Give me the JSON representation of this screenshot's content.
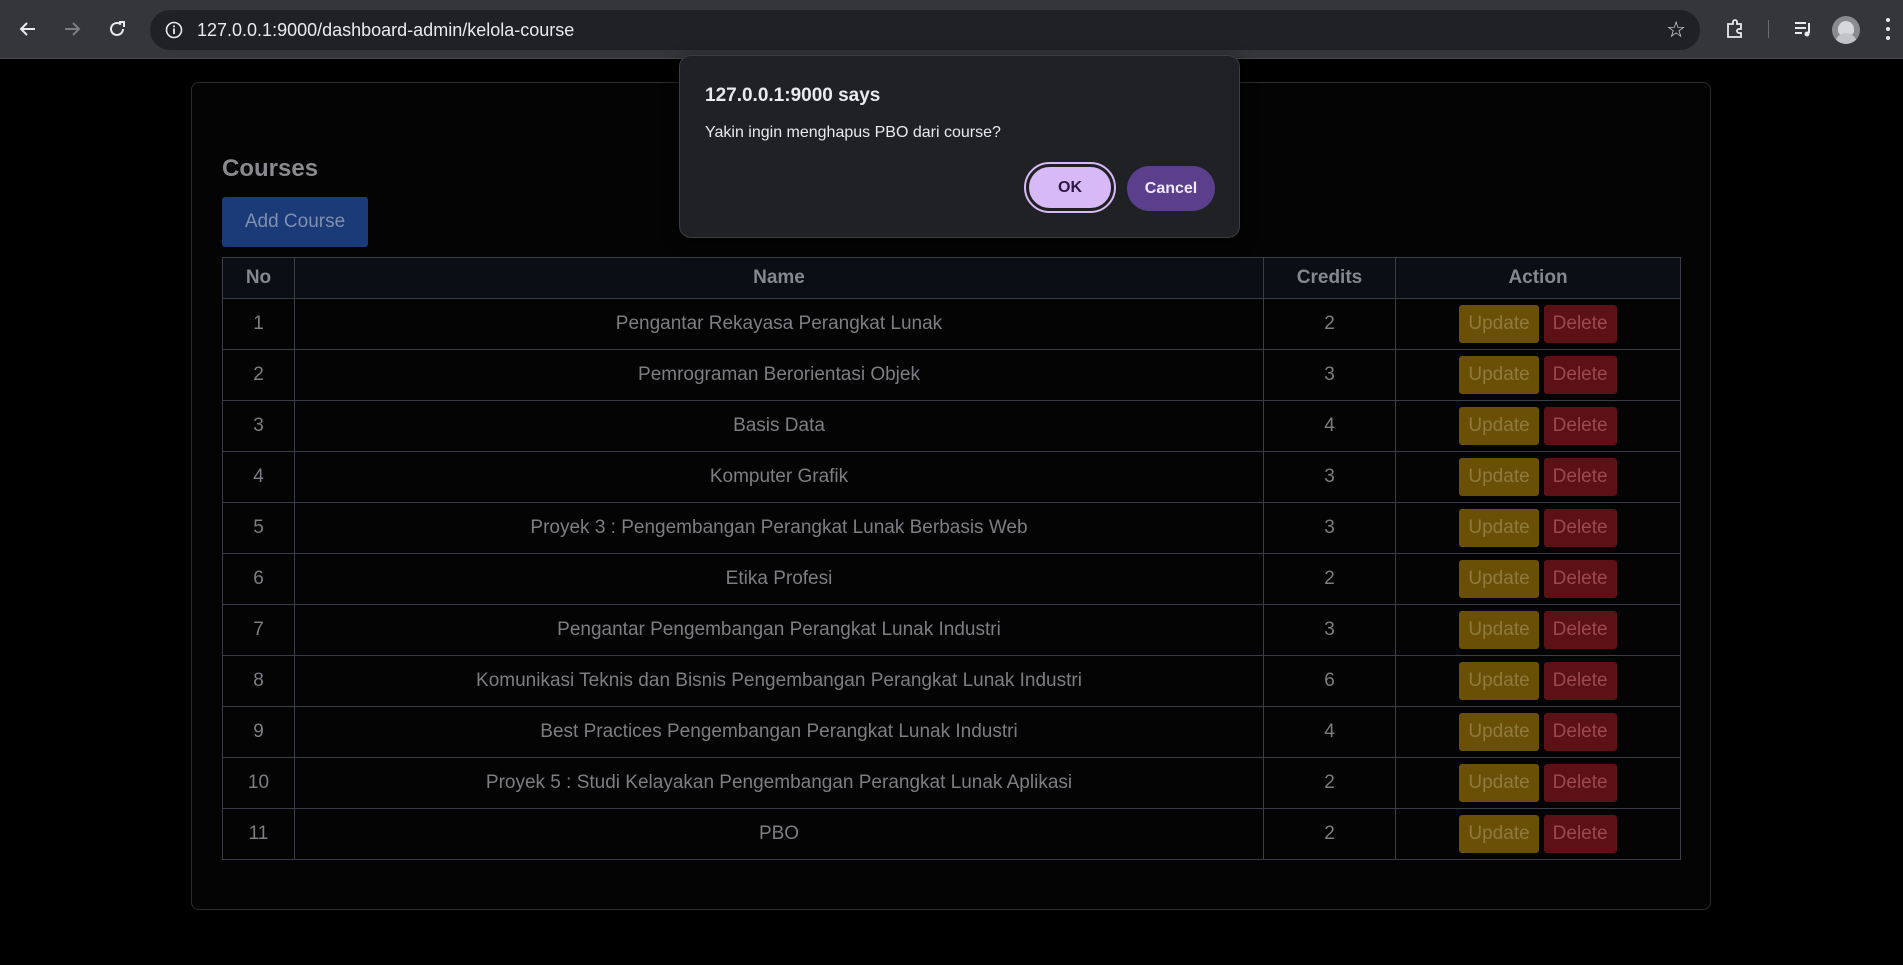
{
  "browser": {
    "url": "127.0.0.1:9000/dashboard-admin/kelola-course",
    "icons": [
      "back-arrow-icon",
      "forward-arrow-icon",
      "reload-icon",
      "site-info-icon",
      "bookmark-star-icon",
      "extensions-icon",
      "media-controls-icon",
      "profile-avatar-icon",
      "more-menu-icon"
    ]
  },
  "page": {
    "section_title": "Courses",
    "add_button": "Add Course",
    "table": {
      "headers": [
        "No",
        "Name",
        "Credits",
        "Action"
      ],
      "update_label": "Update",
      "delete_label": "Delete",
      "rows": [
        {
          "no": "1",
          "name": "Pengantar Rekayasa Perangkat Lunak",
          "credits": "2"
        },
        {
          "no": "2",
          "name": "Pemrograman Berorientasi Objek",
          "credits": "3"
        },
        {
          "no": "3",
          "name": "Basis Data",
          "credits": "4"
        },
        {
          "no": "4",
          "name": "Komputer Grafik",
          "credits": "3"
        },
        {
          "no": "5",
          "name": "Proyek 3 : Pengembangan Perangkat Lunak Berbasis Web",
          "credits": "3"
        },
        {
          "no": "6",
          "name": "Etika Profesi",
          "credits": "2"
        },
        {
          "no": "7",
          "name": "Pengantar Pengembangan Perangkat Lunak Industri",
          "credits": "3"
        },
        {
          "no": "8",
          "name": "Komunikasi Teknis dan Bisnis Pengembangan Perangkat Lunak Industri",
          "credits": "6"
        },
        {
          "no": "9",
          "name": "Best Practices Pengembangan Perangkat Lunak Industri",
          "credits": "4"
        },
        {
          "no": "10",
          "name": "Proyek 5 : Studi Kelayakan Pengembangan Perangkat Lunak Aplikasi",
          "credits": "2"
        },
        {
          "no": "11",
          "name": "PBO",
          "credits": "2"
        }
      ]
    }
  },
  "dialog": {
    "title": "127.0.0.1:9000 says",
    "message": "Yakin ingin menghapus PBO dari course?",
    "ok_label": "OK",
    "cancel_label": "Cancel"
  },
  "colors": {
    "page_background": "#000000",
    "add_button": "#1b3a78",
    "update_button": "#6a4f06",
    "delete_button": "#5c1116",
    "dialog_ok": "#d7b9f7",
    "dialog_cancel": "#5b3f8c"
  }
}
